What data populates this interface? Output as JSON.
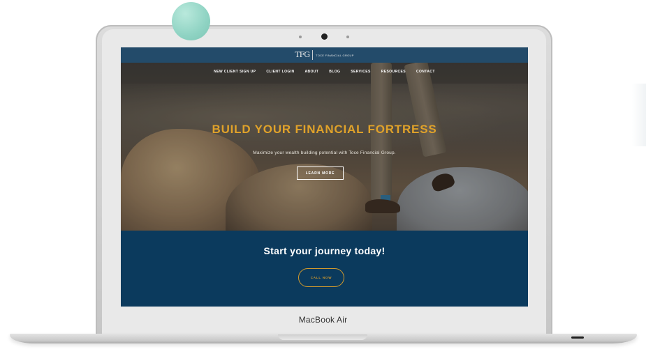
{
  "device": {
    "brand_label": "MacBook Air"
  },
  "site": {
    "logo_mark": "TFG",
    "logo_text": "TOCE FINANCIAL GROUP",
    "nav": [
      "NEW CLIENT SIGN UP",
      "CLIENT LOGIN",
      "ABOUT",
      "BLOG",
      "SERVICES",
      "RESOURCES",
      "CONTACT"
    ],
    "hero": {
      "title": "BUILD YOUR FINANCIAL FORTRESS",
      "subtitle": "Maximize your wealth building potential with Toce Financial Group.",
      "button_label": "LEARN MORE"
    },
    "cta": {
      "title": "Start your journey today!",
      "button_label": "CALL NOW"
    }
  },
  "colors": {
    "accent_gold": "#e0a22a",
    "header_blue": "#234b6a",
    "cta_blue": "#0b3a5d",
    "decor_ball": "#8fd3c3"
  }
}
